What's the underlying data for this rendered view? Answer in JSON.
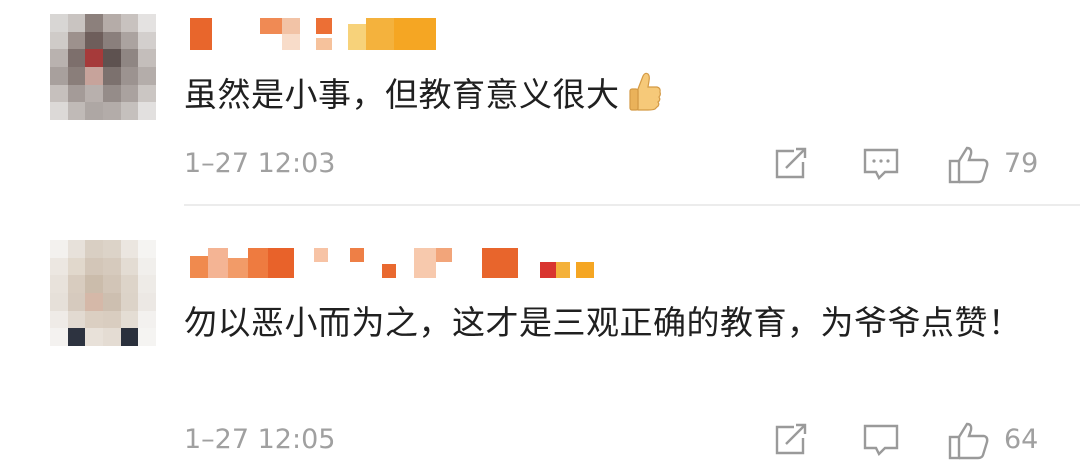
{
  "comments": [
    {
      "text": "虽然是小事，但教育意义很大",
      "emoji": "thumbs-up",
      "time": "1–27 12:03",
      "likes": "79"
    },
    {
      "text": "勿以恶小而为之，这才是三观正确的教育，为爷爷点赞！",
      "time": "1–27 12:05",
      "likes": "64"
    }
  ],
  "icons": {
    "share": "share-icon",
    "comment": "comment-icon",
    "like": "thumbs-up-icon"
  }
}
